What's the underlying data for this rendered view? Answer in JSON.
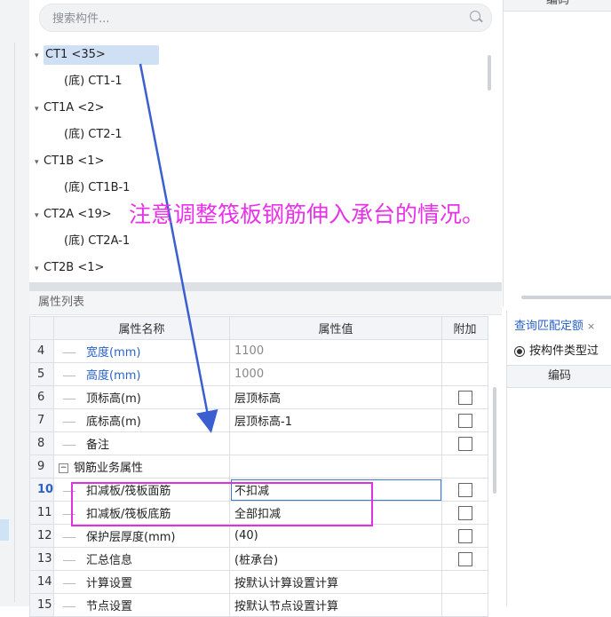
{
  "search": {
    "placeholder": "搜索构件..."
  },
  "tree": {
    "items": [
      {
        "label": "CT1 <35>",
        "level": 0,
        "expanded": true,
        "selected": true
      },
      {
        "label": "(底) CT1-1",
        "level": 1
      },
      {
        "label": "CT1A <2>",
        "level": 0,
        "expanded": true
      },
      {
        "label": "(底) CT2-1",
        "level": 1
      },
      {
        "label": "CT1B <1>",
        "level": 0,
        "expanded": true
      },
      {
        "label": "(底) CT1B-1",
        "level": 1
      },
      {
        "label": "CT2A <19>",
        "level": 0,
        "expanded": true
      },
      {
        "label": "(底) CT2A-1",
        "level": 1
      },
      {
        "label": "CT2B <1>",
        "level": 0,
        "expanded": true
      }
    ]
  },
  "right_top": {
    "header": "编码"
  },
  "props": {
    "title": "属性列表",
    "columns": {
      "name": "属性名称",
      "value": "属性值",
      "extra": "附加"
    },
    "rows": [
      {
        "num": "4",
        "name": "宽度(mm)",
        "value": "1100",
        "name_blue": true,
        "value_gray": true,
        "checkbox": false
      },
      {
        "num": "5",
        "name": "高度(mm)",
        "value": "1000",
        "name_blue": true,
        "value_gray": true,
        "checkbox": false
      },
      {
        "num": "6",
        "name": "顶标高(m)",
        "value": "层顶标高",
        "checkbox": true
      },
      {
        "num": "7",
        "name": "底标高(m)",
        "value": "层顶标高-1",
        "checkbox": true
      },
      {
        "num": "8",
        "name": "备注",
        "value": "",
        "checkbox": true
      },
      {
        "num": "9",
        "name": "钢筋业务属性",
        "value": "",
        "group": true,
        "checkbox": false
      },
      {
        "num": "10",
        "name": "扣减板/筏板面筋",
        "value": "不扣减",
        "active": true,
        "checkbox": true
      },
      {
        "num": "11",
        "name": "扣减板/筏板底筋",
        "value": "全部扣减",
        "checkbox": true
      },
      {
        "num": "12",
        "name": "保护层厚度(mm)",
        "value": "(40)",
        "checkbox": true
      },
      {
        "num": "13",
        "name": "汇总信息",
        "value": "(桩承台)",
        "checkbox": true
      },
      {
        "num": "14",
        "name": "计算设置",
        "value": "按默认计算设置计算",
        "checkbox": false
      },
      {
        "num": "15",
        "name": "节点设置",
        "value": "按默认节点设置计算",
        "checkbox": false
      }
    ]
  },
  "right_bottom": {
    "tab_label": "查询匹配定额",
    "tab_close": "×",
    "radio_label": "按构件类型过",
    "header": "编码"
  },
  "annotation": {
    "text": "注意调整筏板钢筋伸入承台的情况。",
    "color": "#e831e8",
    "arrow_color": "#3a5fd0"
  }
}
